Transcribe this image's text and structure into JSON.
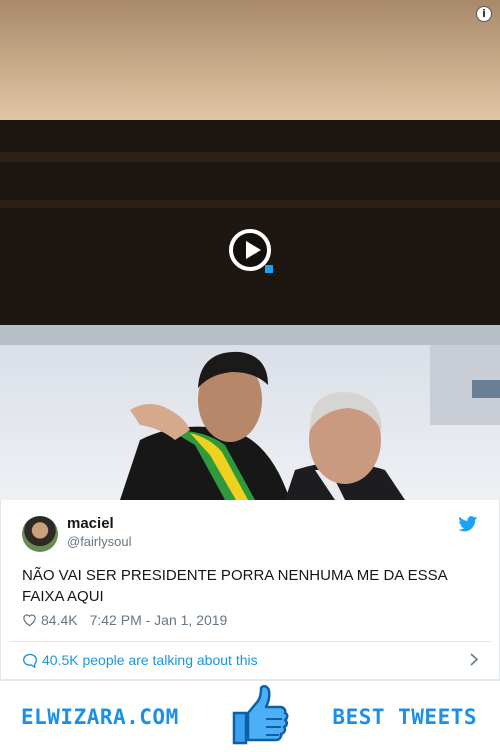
{
  "video": {
    "info_icon": "info-icon",
    "play_icon": "play-icon"
  },
  "tweet": {
    "author": {
      "display_name": "maciel",
      "handle": "@fairlysoul"
    },
    "text": "NÃO VAI SER PRESIDENTE PORRA NENHUMA ME DA ESSA FAIXA AQUI",
    "likes": "84.4K",
    "timestamp": "7:42 PM - Jan 1, 2019",
    "talking_label": "40.5K people are talking about this",
    "colors": {
      "link": "#1b95e0",
      "muted": "#657786",
      "twitter_blue": "#1da1f2"
    }
  },
  "banner": {
    "left_text": "ELWIZARA.COM",
    "right_text": "BEST TWEETS",
    "icon": "thumbs-up-icon",
    "color": "#1d8fe6"
  }
}
